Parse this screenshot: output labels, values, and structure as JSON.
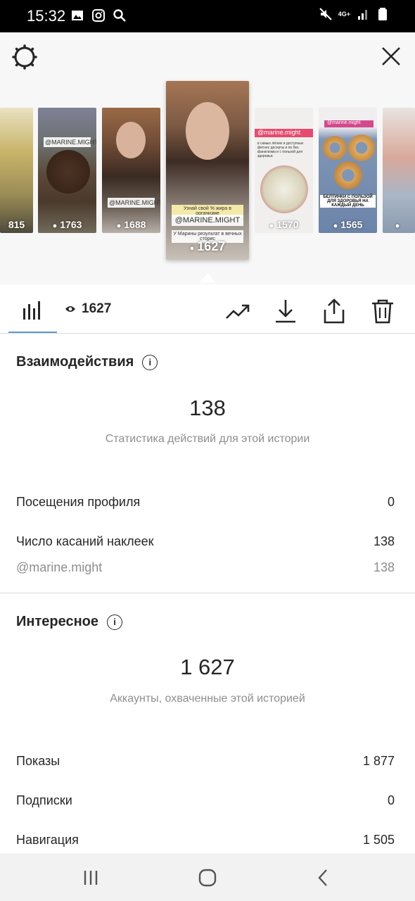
{
  "status_bar": {
    "time": "15:32",
    "network": "4G+"
  },
  "stories": [
    {
      "views": "815",
      "tag": "",
      "color": "#c9b56a"
    },
    {
      "views": "1763",
      "tag": "@MARINE.MIGHT",
      "color": "#6e6552"
    },
    {
      "views": "1688",
      "tag": "@MARINE.MIGHT",
      "color": "#5c4a3e"
    },
    {
      "views": "1627",
      "tag": "@MARINE.MIGHT",
      "color": "#7a5a45"
    },
    {
      "views": "1570",
      "tag": "@marine.might",
      "color": "#f1efee"
    },
    {
      "views": "1565",
      "tag": "@marine.might",
      "color": "#7d8fb0"
    },
    {
      "views": "",
      "tag": "",
      "color": "#c7cfda"
    }
  ],
  "selected_story_caption": "Узнай свой % жира в организме",
  "selected_story_caption2": "У Марины результат в вечных сторис",
  "story_texts": {
    "dessert": "в самых лёгких и доступных фитнес десерты и по без фанатизма и с пользой для здоровья.",
    "bagels": "БЕЛТИНКИ С ПОЛЬЗОЙ ДЛЯ ЗДОРОВЬЯ НА КАЖДЫЙ ДЕНЬ"
  },
  "tabs": {
    "views_count": "1627"
  },
  "interactions": {
    "title": "Взаимодействия",
    "total": "138",
    "caption": "Статистика действий для этой истории",
    "rows": [
      {
        "label": "Посещения профиля",
        "value": "0"
      },
      {
        "label": "Число касаний наклеек",
        "value": "138"
      },
      {
        "label": "@marine.might",
        "value": "138"
      }
    ]
  },
  "discovery": {
    "title": "Интересное",
    "total": "1 627",
    "caption": "Аккаунты, охваченные этой историей",
    "rows": [
      {
        "label": "Показы",
        "value": "1 877"
      },
      {
        "label": "Подписки",
        "value": "0"
      },
      {
        "label": "Навигация",
        "value": "1 505"
      }
    ]
  },
  "colors": {
    "accent": "#5c9ad6",
    "text": "#262626",
    "muted": "#8e8e8e"
  }
}
